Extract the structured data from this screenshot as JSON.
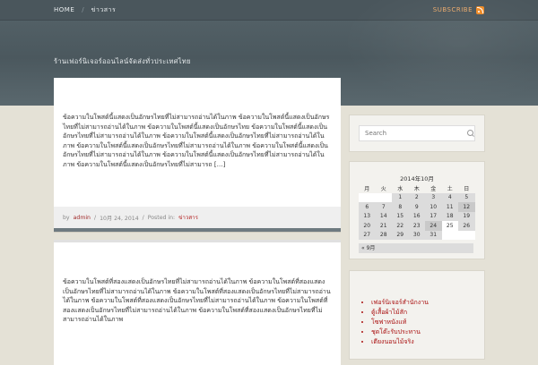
{
  "topbar": {
    "nav": [
      {
        "label": "HOME"
      },
      {
        "label": "ข่าวสาร"
      }
    ],
    "subscribe_label": "SUBSCRIBE"
  },
  "header": {
    "tagline": "ร้านเฟอร์นิเจอร์ออนไลน์จัดส่งทั่วประเทศไทย"
  },
  "posts": [
    {
      "body": "ข้อความในโพสต์นี้แสดงเป็นอักษรไทยที่ไม่สามารถอ่านได้ในภาพ ข้อความในโพสต์นี้แสดงเป็นอักษรไทยที่ไม่สามารถอ่านได้ในภาพ ข้อความในโพสต์นี้แสดงเป็นอักษรไทย ข้อความในโพสต์นี้แสดงเป็นอักษรไทยที่ไม่สามารถอ่านได้ในภาพ ข้อความในโพสต์นี้แสดงเป็นอักษรไทยที่ไม่สามารถอ่านได้ในภาพ ข้อความในโพสต์นี้แสดงเป็นอักษรไทยที่ไม่สามารถอ่านได้ในภาพ ข้อความในโพสต์นี้แสดงเป็นอักษรไทยที่ไม่สามารถอ่านได้ในภาพ ข้อความในโพสต์นี้แสดงเป็นอักษรไทยที่ไม่สามารถอ่านได้ในภาพ ข้อความในโพสต์นี้แสดงเป็นอักษรไทยที่ไม่สามารถ […]",
      "author": "admin",
      "date": "10月 24, 2014",
      "posted_in": "Posted in:",
      "category": "ข่าวสาร"
    },
    {
      "body": "ข้อความในโพสต์ที่สองแสดงเป็นอักษรไทยที่ไม่สามารถอ่านได้ในภาพ ข้อความในโพสต์ที่สองแสดงเป็นอักษรไทยที่ไม่สามารถอ่านได้ในภาพ ข้อความในโพสต์ที่สองแสดงเป็นอักษรไทยที่ไม่สามารถอ่านได้ในภาพ ข้อความในโพสต์ที่สองแสดงเป็นอักษรไทยที่ไม่สามารถอ่านได้ในภาพ ข้อความในโพสต์ที่สองแสดงเป็นอักษรไทยที่ไม่สามารถอ่านได้ในภาพ ข้อความในโพสต์ที่สองแสดงเป็นอักษรไทยที่ไม่สามารถอ่านได้ในภาพ"
    }
  ],
  "sidebar": {
    "search_placeholder": "Search",
    "calendar": {
      "caption": "2014年10月",
      "weekdays": [
        "月",
        "火",
        "水",
        "木",
        "金",
        "土",
        "日"
      ],
      "rows": [
        [
          "",
          "",
          "1",
          "2",
          "3",
          "4",
          "5"
        ],
        [
          "6",
          "7",
          "8",
          "9",
          "10",
          "11",
          "12"
        ],
        [
          "13",
          "14",
          "15",
          "16",
          "17",
          "18",
          "19"
        ],
        [
          "20",
          "21",
          "22",
          "23",
          "24",
          "25",
          "26"
        ],
        [
          "27",
          "28",
          "29",
          "30",
          "31",
          "",
          ""
        ]
      ],
      "prev_link": "« 9月"
    },
    "categories": [
      "เฟอร์นิเจอร์สำนักงาน",
      "ตู้เสื้อผ้าไม้สัก",
      "โซฟาหนังแท้",
      "ชุดโต๊ะรับประทาน",
      "เตียงนอนไม้จริง"
    ]
  }
}
